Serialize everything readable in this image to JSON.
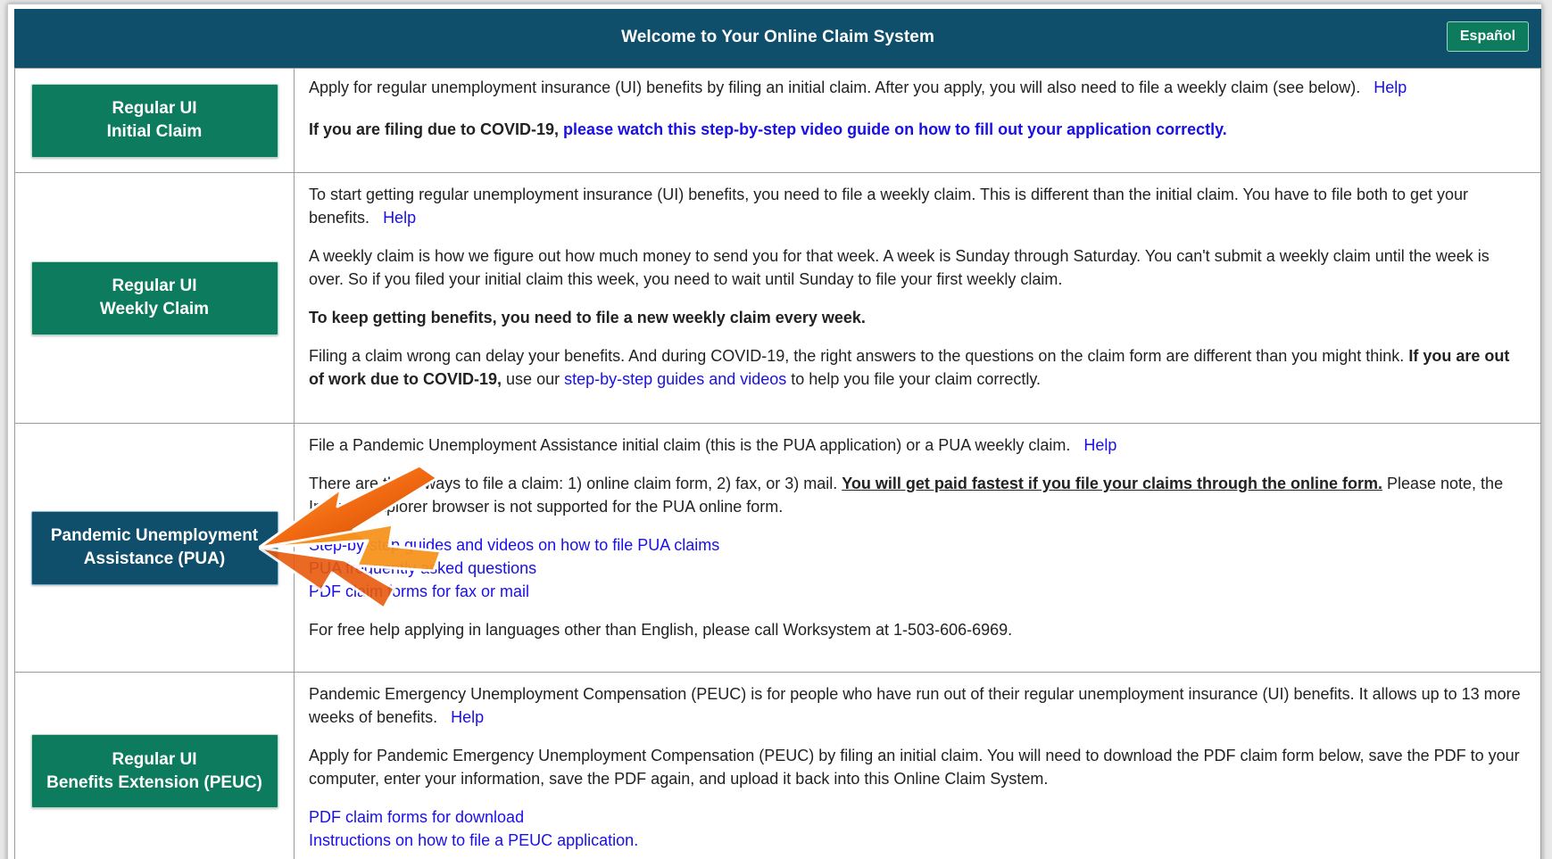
{
  "header": {
    "title": "Welcome to Your Online Claim System",
    "espanol": "Español"
  },
  "rows": {
    "initial": {
      "btn_line1": "Regular UI",
      "btn_line2": "Initial Claim",
      "p1": "Apply for regular unemployment insurance (UI) benefits by filing an initial claim. After you apply, you will also need to file a weekly claim (see below).",
      "help": "Help",
      "covid_lead": "If you are filing due to COVID-19,",
      "covid_link": "please watch this step-by-step video guide on how to fill out your application correctly."
    },
    "weekly": {
      "btn_line1": "Regular UI",
      "btn_line2": "Weekly Claim",
      "p1": "To start getting regular unemployment insurance (UI) benefits, you need to file a weekly claim. This is different than the initial claim. You have to file both to get your benefits.",
      "help": "Help",
      "p2": "A weekly claim is how we figure out how much money to send you for that week. A week is Sunday through Saturday. You can't submit a weekly claim until the week is over. So if you filed your initial claim this week, you need to wait until Sunday to file your first weekly claim.",
      "p3": "To keep getting benefits, you need to file a new weekly claim every week.",
      "p4_a": "Filing a claim wrong can delay your benefits. And during COVID-19, the right answers to the questions on the claim form are different than you might think.",
      "p4_bold": "If you are out of work due to COVID-19,",
      "p4_b": "use our",
      "p4_link": "step-by-step guides and videos",
      "p4_c": "to help you file your claim correctly."
    },
    "pua": {
      "btn_line1": "Pandemic Unemployment",
      "btn_line2": "Assistance (PUA)",
      "p1": "File a Pandemic Unemployment Assistance initial claim (this is the PUA application) or a PUA weekly claim.",
      "help": "Help",
      "p2_a": "There are three ways to file a claim: 1) online claim form, 2) fax, or 3) mail.",
      "p2_u": "You will get paid fastest if you file your claims through the online form.",
      "p2_b": "Please note, the Internet Explorer browser is not supported for the PUA online form.",
      "links": [
        "Step-by-step guides and videos on how to file PUA claims",
        "PUA frequently asked questions",
        "PDF claim forms for fax or mail"
      ],
      "p3": "For free help applying in languages other than English, please call Worksystem at 1-503-606-6969."
    },
    "peuc": {
      "btn_line1": "Regular UI",
      "btn_line2": "Benefits Extension (PEUC)",
      "p1": "Pandemic Emergency Unemployment Compensation (PEUC) is for people who have run out of their regular unemployment insurance (UI) benefits. It allows up to 13 more weeks of benefits.",
      "help": "Help",
      "p2": "Apply for Pandemic Emergency Unemployment Compensation (PEUC) by filing an initial claim. You will need to download the PDF claim form below, save the PDF to your computer, enter your information, save the PDF again, and upload it back into this Online Claim System.",
      "links": [
        "PDF claim forms for download",
        "Instructions on how to file a PEUC application."
      ]
    }
  },
  "colors": {
    "header_bg": "#0f4f6b",
    "green_button": "#0c7b5e",
    "link": "#1a0fe8",
    "arrow": "#f26a12"
  }
}
